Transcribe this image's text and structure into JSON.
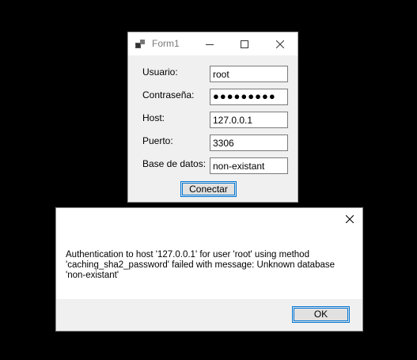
{
  "form_window": {
    "title": "Form1",
    "icons": {
      "app": "app-icon",
      "minimize": "minimize-icon",
      "maximize": "maximize-icon",
      "close": "close-icon"
    },
    "fields": [
      {
        "label": "Usuario:",
        "value": "root"
      },
      {
        "label": "Contraseña:",
        "value": "●●●●●●●●●"
      },
      {
        "label": "Host:",
        "value": "127.0.0.1"
      },
      {
        "label": "Puerto:",
        "value": "3306"
      },
      {
        "label": "Base de datos:",
        "value": "non-existant"
      }
    ],
    "connect_label": "Conectar"
  },
  "message_box": {
    "close_icon": "close-icon",
    "lines": [
      "Authentication to host '127.0.0.1' for user 'root' using method",
      "'caching_sha2_password' failed with message: Unknown database",
      "'non-existant'"
    ],
    "ok_label": "OK"
  },
  "colors": {
    "background": "#000000",
    "accent": "#0078d7",
    "dialog_bg": "#f0f0f0",
    "title_text": "#7a7a7a"
  }
}
